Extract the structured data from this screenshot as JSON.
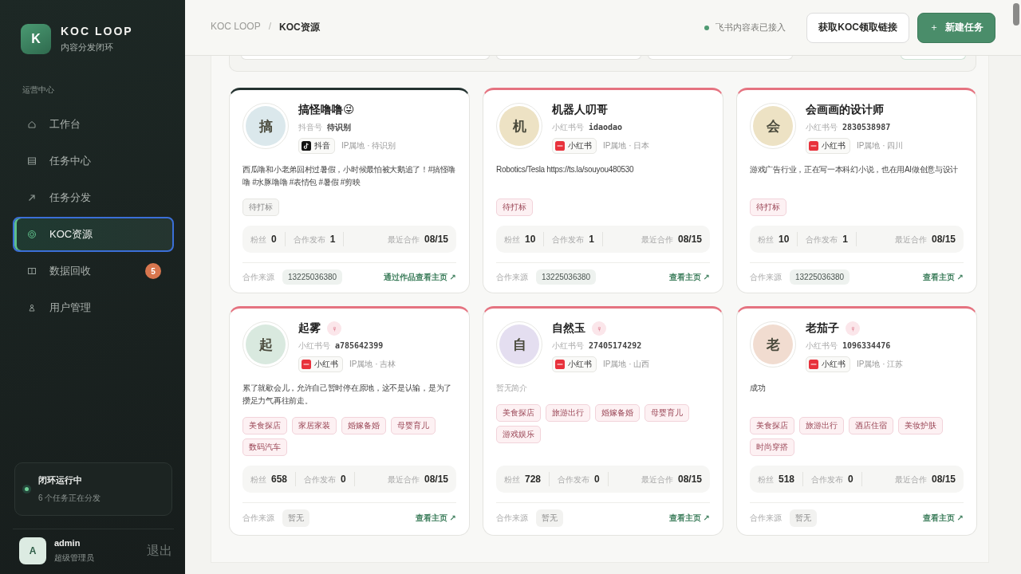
{
  "brand": {
    "logo_letter": "K",
    "name": "KOC LOOP",
    "tagline": "内容分发闭环"
  },
  "sidebar": {
    "section": "运营中心",
    "items": [
      {
        "label": "工作台",
        "kind": "home",
        "selected": false
      },
      {
        "label": "任务中心",
        "kind": "list",
        "selected": false
      },
      {
        "label": "任务分发",
        "kind": "arrow",
        "selected": false
      },
      {
        "label": "KOC资源",
        "kind": "target",
        "selected": true
      },
      {
        "label": "数据回收",
        "kind": "columns",
        "selected": false,
        "badge": "5"
      },
      {
        "label": "用户管理",
        "kind": "user",
        "selected": false
      }
    ],
    "status_card": {
      "title": "闭环运行中",
      "subtitle": "6 个任务正在分发"
    },
    "user": {
      "initial": "A",
      "name": "admin",
      "role": "超级管理员",
      "logout": "退出"
    }
  },
  "header": {
    "breadcrumb": [
      "KOC LOOP",
      "KOC资源"
    ],
    "separator": "/",
    "status": "飞书内容表已接入",
    "buttons": [
      {
        "label": "获取KOC领取链接",
        "kind": "secondary"
      },
      {
        "label": "新建任务",
        "kind": "primary",
        "icon": "＋"
      }
    ]
  },
  "cards": [
    {
      "initial": "搞",
      "color": "#dbe8ec",
      "name": "搞怪噜噜😜",
      "id_label": "抖音号",
      "id_value": "待识别",
      "platform": {
        "kind": "douyin",
        "label": "抖音"
      },
      "ip": "IP属地 · 待识别",
      "bio": "西瓜噜和小老弟回村过暑假，小时候最怕被大鹅追了！#搞怪噜噜 #水豚噜噜 #表情包 #暑假 #剪映",
      "bio_muted": false,
      "tags": [
        "待打标"
      ],
      "stats": [
        {
          "label": "粉丝",
          "value": "0"
        },
        {
          "label": "合作发布",
          "value": "1"
        },
        {
          "label": "最近合作",
          "value": "08/15"
        }
      ],
      "source_label": "合作来源",
      "source": "13225036380",
      "source_set": true,
      "link": "通过作品查看主页 ↗"
    },
    {
      "initial": "机",
      "color": "#ede2c4",
      "name": "机器人叨哥",
      "id_label": "小红书号",
      "id_value": "idaodao",
      "platform": {
        "kind": "xiaohongshu",
        "label": "小红书"
      },
      "ip": "IP属地 · 日本",
      "bio": "Robotics/Tesla https://ts.la/souyou480530",
      "bio_muted": false,
      "tags": [
        "待打标"
      ],
      "stats": [
        {
          "label": "粉丝",
          "value": "10"
        },
        {
          "label": "合作发布",
          "value": "1"
        },
        {
          "label": "最近合作",
          "value": "08/15"
        }
      ],
      "source_label": "合作来源",
      "source": "13225036380",
      "source_set": true,
      "link": "查看主页 ↗"
    },
    {
      "initial": "会",
      "color": "#ede2c4",
      "name": "会画画的设计师",
      "id_label": "小红书号",
      "id_value": "2830538987",
      "platform": {
        "kind": "xiaohongshu",
        "label": "小红书"
      },
      "ip": "IP属地 · 四川",
      "bio": "游戏广告行业，正在写一本科幻小说，也在用AI做创意与设计",
      "bio_muted": false,
      "tags": [
        "待打标"
      ],
      "stats": [
        {
          "label": "粉丝",
          "value": "10"
        },
        {
          "label": "合作发布",
          "value": "1"
        },
        {
          "label": "最近合作",
          "value": "08/15"
        }
      ],
      "source_label": "合作来源",
      "source": "13225036380",
      "source_set": true,
      "link": "查看主页 ↗"
    },
    {
      "initial": "起",
      "color": "#d9e9df",
      "name": "起雾",
      "gender": "♀",
      "id_label": "小红书号",
      "id_value": "a785642399",
      "platform": {
        "kind": "xiaohongshu",
        "label": "小红书"
      },
      "ip": "IP属地 · 吉林",
      "bio": "累了就歇会儿，允许自己暂时停在原地，这不是认输，是为了攒足力气再往前走。",
      "bio_muted": false,
      "tags": [
        "美食探店",
        "家居家装",
        "婚嫁备婚",
        "母婴育儿",
        "数码汽车"
      ],
      "stats": [
        {
          "label": "粉丝",
          "value": "658"
        },
        {
          "label": "合作发布",
          "value": "0"
        },
        {
          "label": "最近合作",
          "value": "08/15"
        }
      ],
      "source_label": "合作来源",
      "source": "暂无",
      "source_set": false,
      "link": "查看主页 ↗"
    },
    {
      "initial": "自",
      "color": "#e4def0",
      "name": "自然玉",
      "gender": "♀",
      "id_label": "小红书号",
      "id_value": "27405174292",
      "platform": {
        "kind": "xiaohongshu",
        "label": "小红书"
      },
      "ip": "IP属地 · 山西",
      "bio": "暂无简介",
      "bio_muted": true,
      "tags": [
        "美食探店",
        "旅游出行",
        "婚嫁备婚",
        "母婴育儿",
        "游戏娱乐"
      ],
      "stats": [
        {
          "label": "粉丝",
          "value": "728"
        },
        {
          "label": "合作发布",
          "value": "0"
        },
        {
          "label": "最近合作",
          "value": "08/15"
        }
      ],
      "source_label": "合作来源",
      "source": "暂无",
      "source_set": false,
      "link": "查看主页 ↗"
    },
    {
      "initial": "老",
      "color": "#f1dcd0",
      "name": "老茄子",
      "gender": "♀",
      "id_label": "小红书号",
      "id_value": "1096334476",
      "platform": {
        "kind": "xiaohongshu",
        "label": "小红书"
      },
      "ip": "IP属地 · 江苏",
      "bio": "成功",
      "bio_muted": false,
      "tags": [
        "美食探店",
        "旅游出行",
        "酒店住宿",
        "美妆护肤",
        "时尚穿搭"
      ],
      "stats": [
        {
          "label": "粉丝",
          "value": "518"
        },
        {
          "label": "合作发布",
          "value": "0"
        },
        {
          "label": "最近合作",
          "value": "08/15"
        }
      ],
      "source_label": "合作来源",
      "source": "暂无",
      "source_set": false,
      "link": "查看主页 ↗"
    }
  ]
}
